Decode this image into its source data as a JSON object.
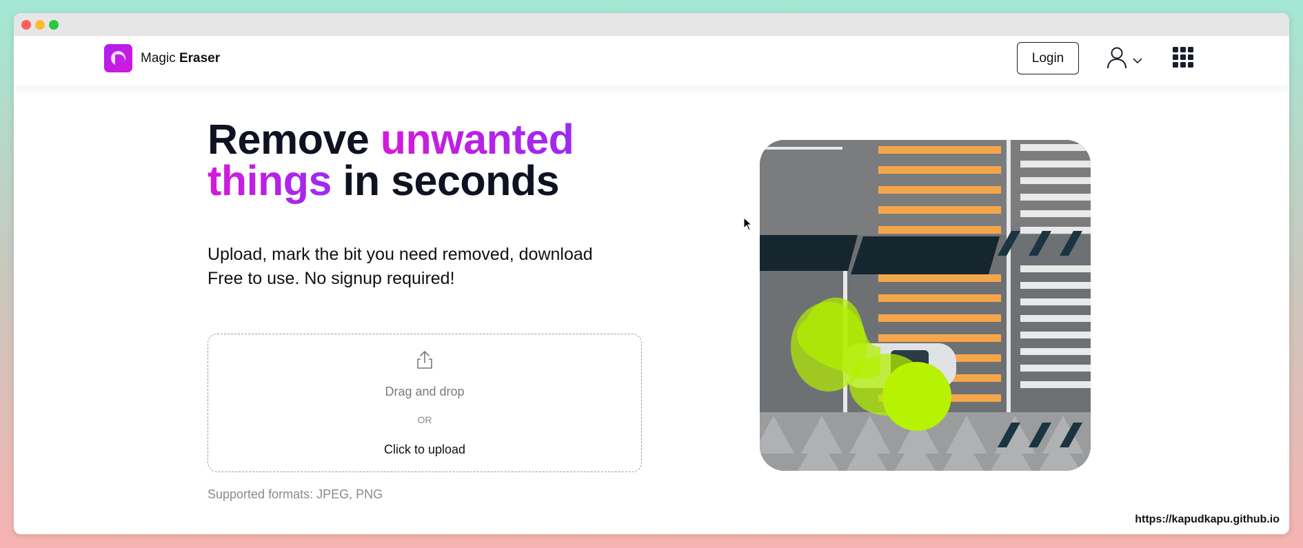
{
  "brand": {
    "name_regular": "Magic",
    "name_bold": "Eraser"
  },
  "nav": {
    "login_label": "Login"
  },
  "hero": {
    "headline_part1": "Remove ",
    "headline_accent1": "unwanted",
    "headline_accent2": "things",
    "headline_part2": " in seconds",
    "subtitle_line1": "Upload, mark the bit you need removed, download",
    "subtitle_line2": "Free to use. No signup required!"
  },
  "upload": {
    "drag_label": "Drag and drop",
    "or_label": "OR",
    "click_label": "Click to upload",
    "formats": "Supported formats: JPEG, PNG"
  },
  "watermark": "https://kapudkapu.github.io",
  "colors": {
    "accent_start": "#d51ad9",
    "accent_end": "#9b2af2",
    "highlight": "#b4f000"
  }
}
